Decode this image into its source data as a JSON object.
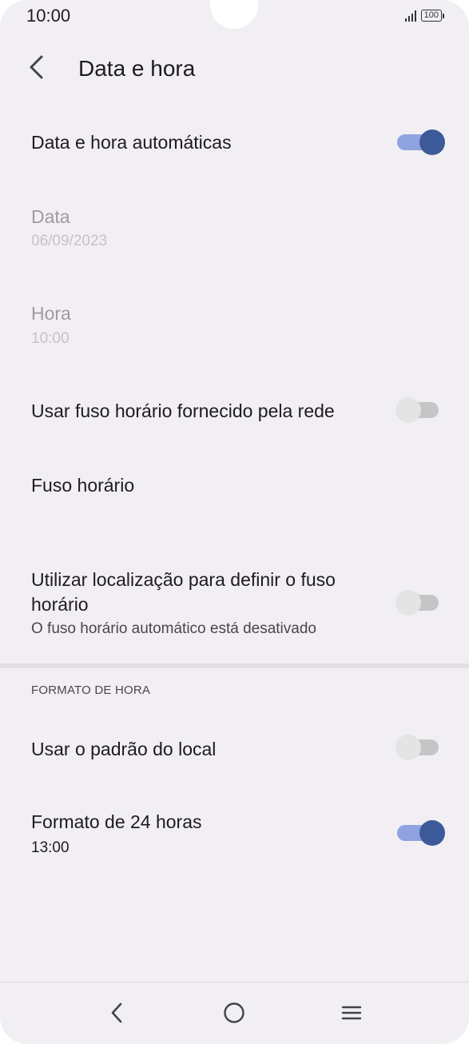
{
  "status_bar": {
    "time": "10:00",
    "battery": "100",
    "icons": [
      "signal-icon",
      "battery-icon"
    ]
  },
  "header": {
    "title": "Data e hora",
    "back_icon": "back-arrow-icon"
  },
  "settings": {
    "auto_datetime": {
      "title": "Data e hora automáticas",
      "enabled": true
    },
    "date": {
      "title": "Data",
      "value": "06/09/2023"
    },
    "time": {
      "title": "Hora",
      "value": "10:00"
    },
    "network_timezone": {
      "title": "Usar fuso horário fornecido pela rede",
      "enabled": false
    },
    "timezone": {
      "title": "Fuso horário"
    },
    "location_timezone": {
      "title_line1": "Utilizar localização para definir o fuso",
      "title_line2": "horário",
      "subtitle": "O fuso horário automático está desativado",
      "enabled": false
    }
  },
  "time_format": {
    "section_header": "FORMATO DE HORA",
    "locale_default": {
      "title": "Usar o padrão do local",
      "enabled": false
    },
    "format_24h": {
      "title": "Formato de 24 horas",
      "value": "13:00",
      "enabled": true
    }
  },
  "colors": {
    "background": "#f2eff4",
    "toggle_on_thumb": "#3c5a99",
    "toggle_on_track": "#8fa3e0",
    "toggle_off_thumb": "#e4e4e4",
    "toggle_off_track": "#c5c5c5"
  },
  "nav_bar": {
    "icons": [
      "back-nav-icon",
      "home-nav-icon",
      "menu-nav-icon"
    ]
  }
}
